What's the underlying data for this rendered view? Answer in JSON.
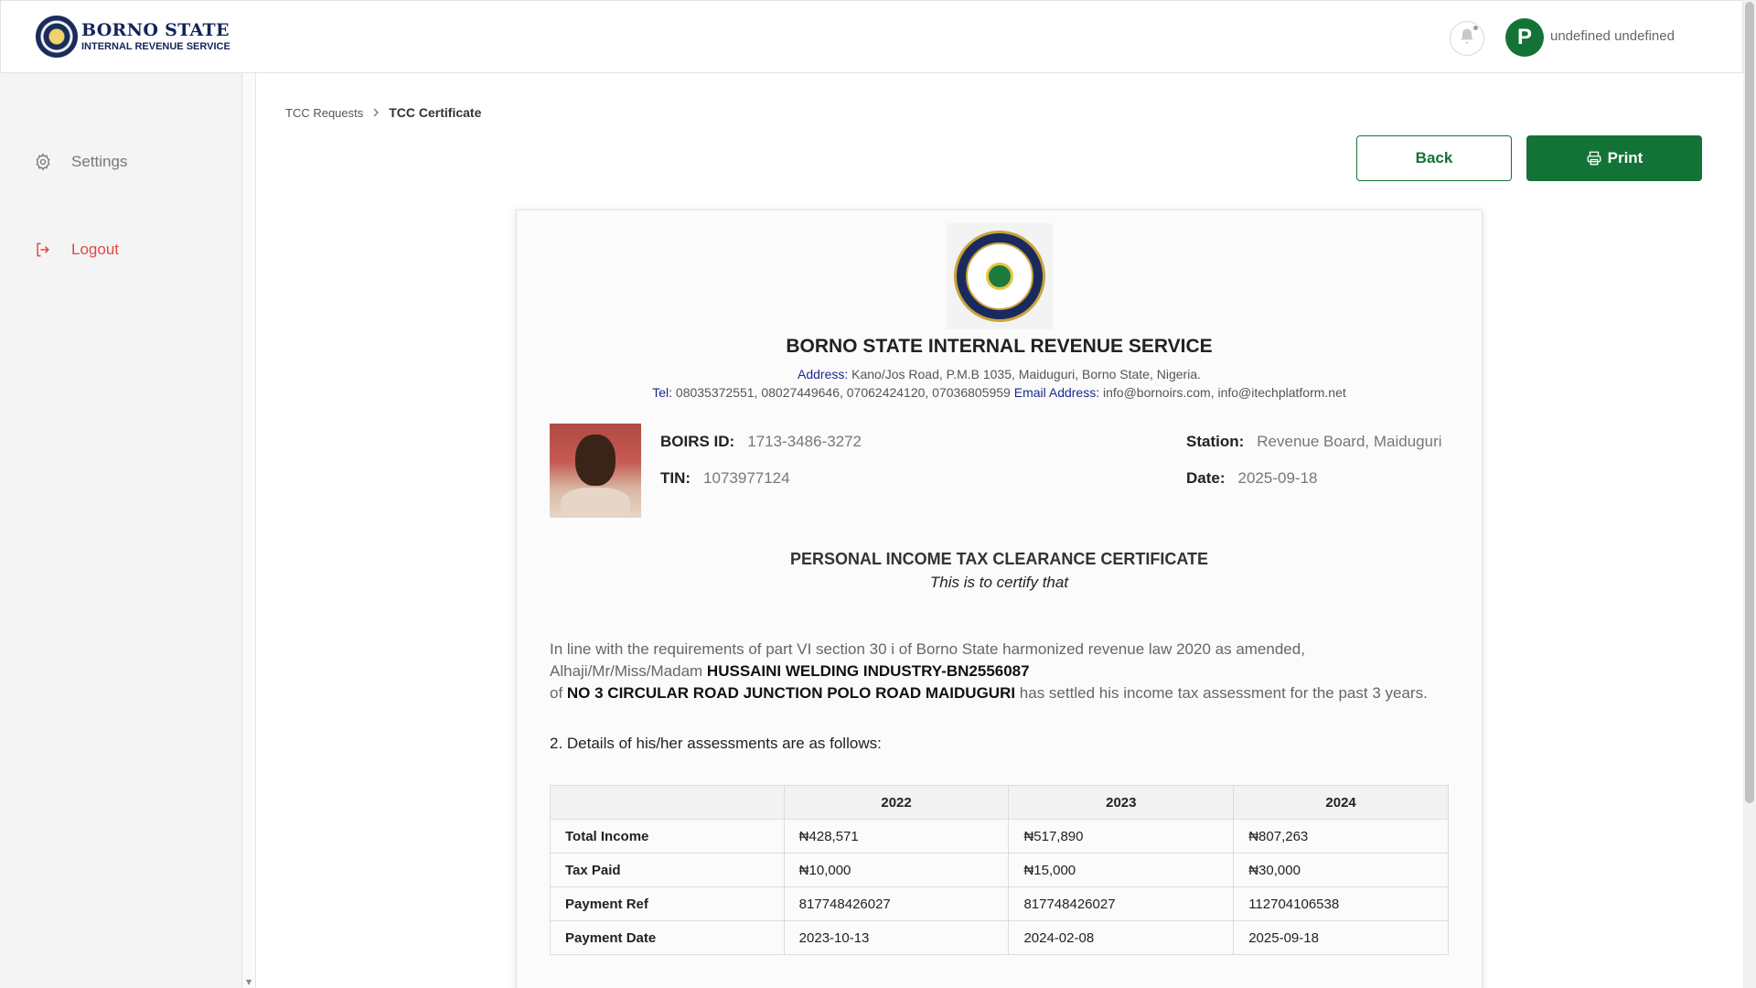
{
  "header": {
    "logo_line1": "BORNO STATE",
    "logo_line2": "INTERNAL REVENUE SERVICE",
    "avatar_letter": "P",
    "username": "undefined undefined"
  },
  "sidebar": {
    "items": [
      {
        "label": "Settings",
        "icon": "gear-icon"
      },
      {
        "label": "Logout",
        "icon": "logout-icon"
      }
    ]
  },
  "breadcrumb": {
    "parent": "TCC Requests",
    "current": "TCC Certificate"
  },
  "actions": {
    "back_label": "Back",
    "print_label": "Print"
  },
  "certificate": {
    "org_name": "BORNO STATE INTERNAL REVENUE SERVICE",
    "address_label": "Address:",
    "address": " Kano/Jos Road, P.M.B 1035, Maiduguri, Borno State, Nigeria.",
    "tel_label": "Tel:",
    "tel": " 08035372551, 08027449646, 07062424120, 07036805959 ",
    "email_label": "Email Address:",
    "email": " info@bornoirs.com, info@itechplatform.net",
    "boirs_id_label": "BOIRS ID:",
    "boirs_id": "1713-3486-3272",
    "tin_label": "TIN:",
    "tin": "1073977124",
    "station_label": "Station:",
    "station": "Revenue Board, Maiduguri",
    "date_label": "Date:",
    "date": "2025-09-18",
    "title": "PERSONAL INCOME TAX CLEARANCE CERTIFICATE",
    "subtitle": "This is to certify that",
    "para_line1": "In line with the requirements of part VI section 30 i of Borno State harmonized revenue law 2020 as amended,",
    "para_prefix2": "Alhaji/Mr/Miss/Madam ",
    "taxpayer_name": "HUSSAINI WELDING INDUSTRY-BN2556087",
    "para_prefix3": "of ",
    "taxpayer_address": "NO 3 CIRCULAR ROAD JUNCTION POLO ROAD MAIDUGURI",
    "para_suffix3": " has settled his income tax assessment for the past 3 years.",
    "details_heading": "2. Details of his/her assessments are as follows:",
    "table": {
      "headers": [
        "",
        "2022",
        "2023",
        "2024"
      ],
      "rows": [
        {
          "label": "Total Income",
          "values": [
            "₦428,571",
            "₦517,890",
            "₦807,263"
          ]
        },
        {
          "label": "Tax Paid",
          "values": [
            "₦10,000",
            "₦15,000",
            "₦30,000"
          ]
        },
        {
          "label": "Payment Ref",
          "values": [
            "817748426027",
            "817748426027",
            "112704106538"
          ]
        },
        {
          "label": "Payment Date",
          "values": [
            "2023-10-13",
            "2024-02-08",
            "2025-09-18"
          ]
        }
      ]
    }
  },
  "colors": {
    "brand_green": "#137337",
    "logout_red": "#e04848",
    "label_blue": "#1b2a8a"
  }
}
